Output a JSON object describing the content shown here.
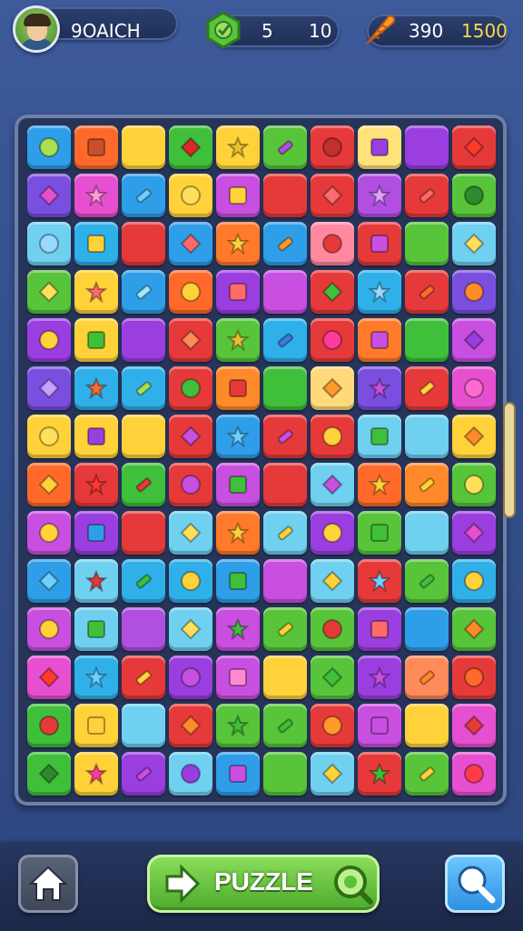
{
  "player": {
    "name": "9OAICH",
    "avatar_icon": "player-avatar"
  },
  "moves": {
    "current": "5",
    "max": "10",
    "icon": "green-gem-icon"
  },
  "score": {
    "current": "390",
    "target": "1500",
    "icon": "carrot-icon"
  },
  "board": {
    "rows": [
      [
        "#2f9ee8",
        "#ff6a2a",
        "#ffd23a",
        "#3fbf3a",
        "#ffd23a",
        "#57c43a",
        "#e63a3a",
        "#ffe27a",
        "#9a3ee0",
        "#e63a3a"
      ],
      [
        "#7a4fe0",
        "#e64fd0",
        "#2f9ee8",
        "#ffd23a",
        "#c84fe0",
        "#e63a3a",
        "#e63a3a",
        "#b04fe0",
        "#e63a3a",
        "#57c43a"
      ],
      [
        "#6fd0f0",
        "#2fb0e8",
        "#e63a3a",
        "#2f9ee8",
        "#ff7a2a",
        "#2f9ee8",
        "#ff8aa0",
        "#e63a3a",
        "#57c43a",
        "#6fd0f0"
      ],
      [
        "#57c43a",
        "#ffd23a",
        "#2f9ee8",
        "#ff6a2a",
        "#9a3ee0",
        "#c84fe0",
        "#e63a3a",
        "#2fb0e8",
        "#e63a3a",
        "#7a4fe0"
      ],
      [
        "#9a3ee0",
        "#ffd23a",
        "#9a3ee0",
        "#e63a3a",
        "#57c43a",
        "#2fb0e8",
        "#e63a3a",
        "#ff7a2a",
        "#3fbf3a",
        "#c84fe0"
      ],
      [
        "#7a4fe0",
        "#2fb0e8",
        "#2fb0e8",
        "#e63a3a",
        "#ff8a2a",
        "#3fbf3a",
        "#ffd97a",
        "#7a4fe0",
        "#e63a3a",
        "#e64fd0"
      ],
      [
        "#ffd23a",
        "#ffd23a",
        "#ffd23a",
        "#e63a3a",
        "#2f9ee8",
        "#e63a3a",
        "#e63a3a",
        "#6fd0f0",
        "#6fd0f0",
        "#ffd23a"
      ],
      [
        "#ff6a2a",
        "#e63a3a",
        "#3fbf3a",
        "#e63a3a",
        "#c84fe0",
        "#e63a3a",
        "#6fd0f0",
        "#ff6a2a",
        "#ff8a2a",
        "#57c43a"
      ],
      [
        "#c84fe0",
        "#9a3ee0",
        "#e63a3a",
        "#6fd0f0",
        "#ff7a2a",
        "#6fd0f0",
        "#9a3ee0",
        "#57c43a",
        "#6fd0f0",
        "#9a3ee0"
      ],
      [
        "#2f9ee8",
        "#6fd0f0",
        "#2fb0e8",
        "#2fb0e8",
        "#2f9ee8",
        "#c84fe0",
        "#6fd0f0",
        "#e63a3a",
        "#57c43a",
        "#2fb0e8"
      ],
      [
        "#c84fe0",
        "#6fd0f0",
        "#b04fe0",
        "#6fd0f0",
        "#c84fe0",
        "#57c43a",
        "#57c43a",
        "#9a3ee0",
        "#2f9ee8",
        "#57c43a"
      ],
      [
        "#e64fd0",
        "#2fb0e8",
        "#e63a3a",
        "#9a3ee0",
        "#c84fe0",
        "#ffd23a",
        "#57c43a",
        "#9a3ee0",
        "#ff8a5a",
        "#e63a3a"
      ],
      [
        "#3fbf3a",
        "#ffd23a",
        "#6fd0f0",
        "#e63a3a",
        "#57c43a",
        "#57c43a",
        "#e63a3a",
        "#c84fe0",
        "#ffd23a",
        "#e64fd0"
      ],
      [
        "#3fbf3a",
        "#ffd23a",
        "#9a3ee0",
        "#6fd0f0",
        "#2f9ee8",
        "#57c43a",
        "#6fd0f0",
        "#e63a3a",
        "#57c43a",
        "#e64fd0"
      ]
    ],
    "symbols": [
      [
        "#a8e050",
        "#c84f2a",
        "#2f6ee0",
        "#d92a2a",
        "#e8c030",
        "#b04fe0",
        "#c03030",
        "#9a3ee0",
        "#b080ff",
        "#ff3a2a"
      ],
      [
        "#e64fd0",
        "#ff9ad8",
        "#6fd0ff",
        "#ffe05a",
        "#ffd23a",
        "#c84fe0",
        "#ff6a6a",
        "#e0a0ff",
        "#ff6a6a",
        "#2f8a2f"
      ],
      [
        "#9ad8ff",
        "#ffd23a",
        "#6fc0ff",
        "#ff6a6a",
        "#ffd23a",
        "#ff9a2a",
        "#e63a3a",
        "#c84fe0",
        "#ffd23a",
        "#ffe05a"
      ],
      [
        "#ffe05a",
        "#ff6a6a",
        "#a0e8ff",
        "#ffd23a",
        "#ff6a6a",
        "#6fd0ff",
        "#3fbf3a",
        "#9ad8ff",
        "#ff6a2a",
        "#ff8a2a"
      ],
      [
        "#ffd23a",
        "#3fbf3a",
        "#6fd0ff",
        "#ff8a5a",
        "#e8c030",
        "#3f7ae0",
        "#ff3a9a",
        "#c84fe0",
        "#3fbf3a",
        "#9a3ee0"
      ],
      [
        "#c8a0ff",
        "#ff6a2a",
        "#a8e050",
        "#3fbf3a",
        "#e63a3a",
        "#ffd23a",
        "#ff9a2a",
        "#c84fe0",
        "#ffd23a",
        "#ff6ad0"
      ],
      [
        "#ffe05a",
        "#9a3ee0",
        "#c84fe0",
        "#c84fe0",
        "#6fd0ff",
        "#c84fe0",
        "#ffd23a",
        "#3fbf3a",
        "#9a3ee0",
        "#ff8a2a"
      ],
      [
        "#ffd23a",
        "#ff3a2a",
        "#e63a3a",
        "#c84fe0",
        "#3fbf3a",
        "#2f6ee0",
        "#c84fe0",
        "#ffd23a",
        "#ffd23a",
        "#ffe05a"
      ],
      [
        "#ffd23a",
        "#2f9ee8",
        "#ff6a2a",
        "#ffe05a",
        "#ffd23a",
        "#ffd23a",
        "#ffd23a",
        "#3fbf3a",
        "#9a3ee0",
        "#e64fd0"
      ],
      [
        "#6fd0ff",
        "#e63a3a",
        "#3fbf3a",
        "#ffd23a",
        "#3fbf3a",
        "#ff6a2a",
        "#ffd23a",
        "#6fd0ff",
        "#3fbf3a",
        "#ffd23a"
      ],
      [
        "#ffd23a",
        "#3fbf3a",
        "#ffd23a",
        "#ffe05a",
        "#3fbf3a",
        "#ffd23a",
        "#e63a3a",
        "#ff6a6a",
        "#e63a3a",
        "#ff8a2a"
      ],
      [
        "#ff3a2a",
        "#6fd0ff",
        "#ffd23a",
        "#c84fe0",
        "#ff8ad0",
        "#ffd23a",
        "#3fbf3a",
        "#c84fe0",
        "#ff8a2a",
        "#ff6a2a"
      ],
      [
        "#e63a3a",
        "#ffd23a",
        "#2f9ee8",
        "#ff8a2a",
        "#3fbf3a",
        "#3fbf3a",
        "#ff9a2a",
        "#c84fe0",
        "#ffd23a",
        "#e63a3a"
      ],
      [
        "#2f8a2f",
        "#ff3a9a",
        "#c84fe0",
        "#9a3ee0",
        "#c84fe0",
        "#ffd23a",
        "#ffd23a",
        "#3fbf3a",
        "#ffd23a",
        "#ff3a4a"
      ]
    ]
  },
  "bottom": {
    "home_icon": "home-icon",
    "puzzle_label": "PUZZLE",
    "search_icon": "search-icon"
  }
}
